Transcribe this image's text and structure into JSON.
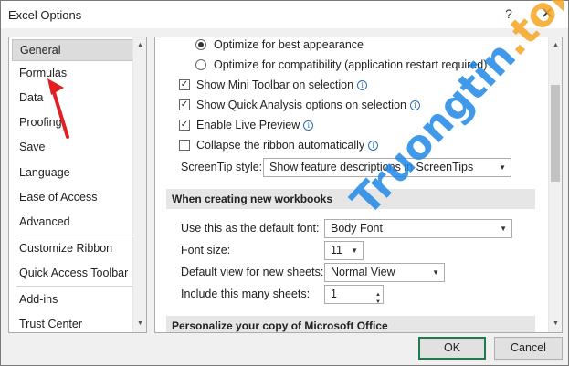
{
  "window": {
    "title": "Excel Options",
    "help_glyph": "?",
    "close_glyph": "✕"
  },
  "sidebar": {
    "items": [
      {
        "label": "General",
        "selected": true
      },
      {
        "label": "Formulas"
      },
      {
        "label": "Data"
      },
      {
        "label": "Proofing"
      },
      {
        "label": "Save"
      },
      {
        "label": "Language"
      },
      {
        "label": "Ease of Access"
      },
      {
        "label": "Advanced"
      },
      {
        "label": "Customize Ribbon"
      },
      {
        "label": "Quick Access Toolbar"
      },
      {
        "label": "Add-ins"
      },
      {
        "label": "Trust Center"
      }
    ]
  },
  "options": {
    "radio_best_appearance": "Optimize for best appearance",
    "radio_compatibility": "Optimize for compatibility (application restart required)",
    "mini_toolbar": "Show Mini Toolbar on selection",
    "quick_analysis": "Show Quick Analysis options on selection",
    "live_preview": "Enable Live Preview",
    "collapse_ribbon": "Collapse the ribbon automatically",
    "screentip_label": "ScreenTip style:",
    "screentip_value": "Show feature descriptions in ScreenTips",
    "checkmark": "✓",
    "info_glyph": "i"
  },
  "new_workbooks": {
    "heading": "When creating new workbooks",
    "default_font_label": "Use this as the default font:",
    "default_font_value": "Body Font",
    "font_size_label": "Font size:",
    "font_size_value": "11",
    "default_view_label": "Default view for new sheets:",
    "default_view_value": "Normal View",
    "sheets_label": "Include this many sheets:",
    "sheets_value": "1"
  },
  "personalize": {
    "heading": "Personalize your copy of Microsoft Office"
  },
  "buttons": {
    "ok": "OK",
    "cancel": "Cancel"
  },
  "watermark": {
    "text": "Truongtin.top"
  },
  "colors": {
    "accent_green": "#1f7a4d",
    "arrow_red": "#e02020",
    "watermark_blue": "#1e88e5",
    "watermark_orange": "#f5a623"
  }
}
